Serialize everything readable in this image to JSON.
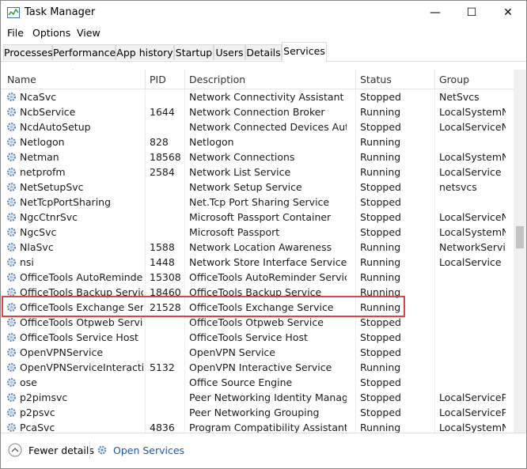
{
  "window": {
    "title": "Task Manager",
    "minimize": "—",
    "maximize": "☐",
    "close": "✕"
  },
  "menu": [
    "File",
    "Options",
    "View"
  ],
  "tabs": [
    "Processes",
    "Performance",
    "App history",
    "Startup",
    "Users",
    "Details",
    "Services"
  ],
  "active_tab": "Services",
  "columns": {
    "name": "Name",
    "pid": "PID",
    "description": "Description",
    "status": "Status",
    "group": "Group"
  },
  "services": [
    {
      "name": "NcaSvc",
      "pid": "",
      "description": "Network Connectivity Assistant",
      "status": "Stopped",
      "group": "NetSvcs"
    },
    {
      "name": "NcbService",
      "pid": "1644",
      "description": "Network Connection Broker",
      "status": "Running",
      "group": "LocalSystemN..."
    },
    {
      "name": "NcdAutoSetup",
      "pid": "",
      "description": "Network Connected Devices Auto-S...",
      "status": "Stopped",
      "group": "LocalServiceN..."
    },
    {
      "name": "Netlogon",
      "pid": "828",
      "description": "Netlogon",
      "status": "Running",
      "group": ""
    },
    {
      "name": "Netman",
      "pid": "18568",
      "description": "Network Connections",
      "status": "Running",
      "group": "LocalSystemN..."
    },
    {
      "name": "netprofm",
      "pid": "2584",
      "description": "Network List Service",
      "status": "Running",
      "group": "LocalService"
    },
    {
      "name": "NetSetupSvc",
      "pid": "",
      "description": "Network Setup Service",
      "status": "Stopped",
      "group": "netsvcs"
    },
    {
      "name": "NetTcpPortSharing",
      "pid": "",
      "description": "Net.Tcp Port Sharing Service",
      "status": "Stopped",
      "group": ""
    },
    {
      "name": "NgcCtnrSvc",
      "pid": "",
      "description": "Microsoft Passport Container",
      "status": "Stopped",
      "group": "LocalServiceN..."
    },
    {
      "name": "NgcSvc",
      "pid": "",
      "description": "Microsoft Passport",
      "status": "Stopped",
      "group": "LocalSystemN..."
    },
    {
      "name": "NlaSvc",
      "pid": "1588",
      "description": "Network Location Awareness",
      "status": "Running",
      "group": "NetworkService"
    },
    {
      "name": "nsi",
      "pid": "1448",
      "description": "Network Store Interface Service",
      "status": "Running",
      "group": "LocalService"
    },
    {
      "name": "OfficeTools AutoReminder ...",
      "pid": "15308",
      "description": "OfficeTools AutoReminder Service",
      "status": "Running",
      "group": ""
    },
    {
      "name": "OfficeTools Backup Service",
      "pid": "18460",
      "description": "OfficeTools Backup Service",
      "status": "Running",
      "group": ""
    },
    {
      "name": "OfficeTools Exchange Service",
      "pid": "21528",
      "description": "OfficeTools Exchange Service",
      "status": "Running",
      "group": ""
    },
    {
      "name": "OfficeTools Otpweb Service",
      "pid": "",
      "description": "OfficeTools Otpweb Service",
      "status": "Stopped",
      "group": ""
    },
    {
      "name": "OfficeTools Service Host",
      "pid": "",
      "description": "OfficeTools Service Host",
      "status": "Stopped",
      "group": ""
    },
    {
      "name": "OpenVPNService",
      "pid": "",
      "description": "OpenVPN Service",
      "status": "Stopped",
      "group": ""
    },
    {
      "name": "OpenVPNServiceInteractive",
      "pid": "5132",
      "description": "OpenVPN Interactive Service",
      "status": "Running",
      "group": ""
    },
    {
      "name": "ose",
      "pid": "",
      "description": "Office  Source Engine",
      "status": "Stopped",
      "group": ""
    },
    {
      "name": "p2pimsvc",
      "pid": "",
      "description": "Peer Networking Identity Manager",
      "status": "Stopped",
      "group": "LocalServiceP..."
    },
    {
      "name": "p2psvc",
      "pid": "",
      "description": "Peer Networking Grouping",
      "status": "Stopped",
      "group": "LocalServiceP..."
    },
    {
      "name": "PcaSvc",
      "pid": "4836",
      "description": "Program Compatibility Assistant Ser...",
      "status": "Running",
      "group": "LocalSystemN..."
    }
  ],
  "highlighted_service": "OfficeTools Exchange Service",
  "footer": {
    "fewer_details": "Fewer details",
    "open_services": "Open Services"
  },
  "colors": {
    "highlight_border": "#e0443e",
    "link": "#1a56b5",
    "gear": "#6b8fb8"
  },
  "icons": {
    "app": "task-manager-icon",
    "service": "gear-icon",
    "fewer": "chevron-up-circle-icon",
    "open": "services-gear-icon"
  }
}
